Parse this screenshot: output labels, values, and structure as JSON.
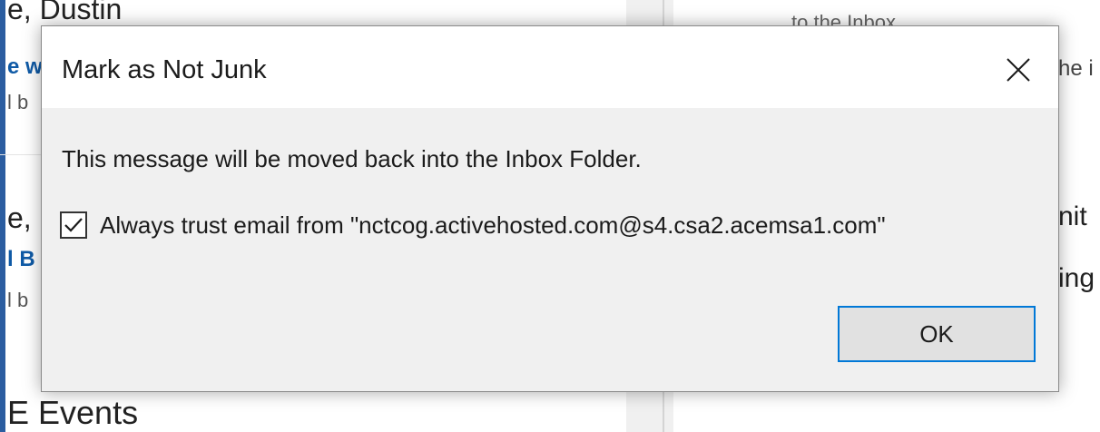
{
  "background_list": {
    "items": [
      {
        "sender": "e, Dustin",
        "subject": "e w",
        "preview": "l b"
      },
      {
        "sender": "e,",
        "subject": "l B",
        "preview": "l b"
      }
    ],
    "section_heading": "E Events"
  },
  "reading_pane": {
    "line1": "to the Inbox",
    "line2": "he i",
    "line3": "nit",
    "line4": "ing"
  },
  "dialog": {
    "title": "Mark as Not Junk",
    "message": "This message will be moved back into the Inbox Folder.",
    "checkbox_label": "Always trust email from \"nctcog.activehosted.com@s4.csa2.acemsa1.com\"",
    "checkbox_checked": true,
    "ok_label": "OK"
  },
  "colors": {
    "accent": "#0078d7",
    "desktop_blue": "#1f4f8f"
  },
  "icons": {
    "close": "close-icon",
    "check": "checkmark-icon"
  }
}
